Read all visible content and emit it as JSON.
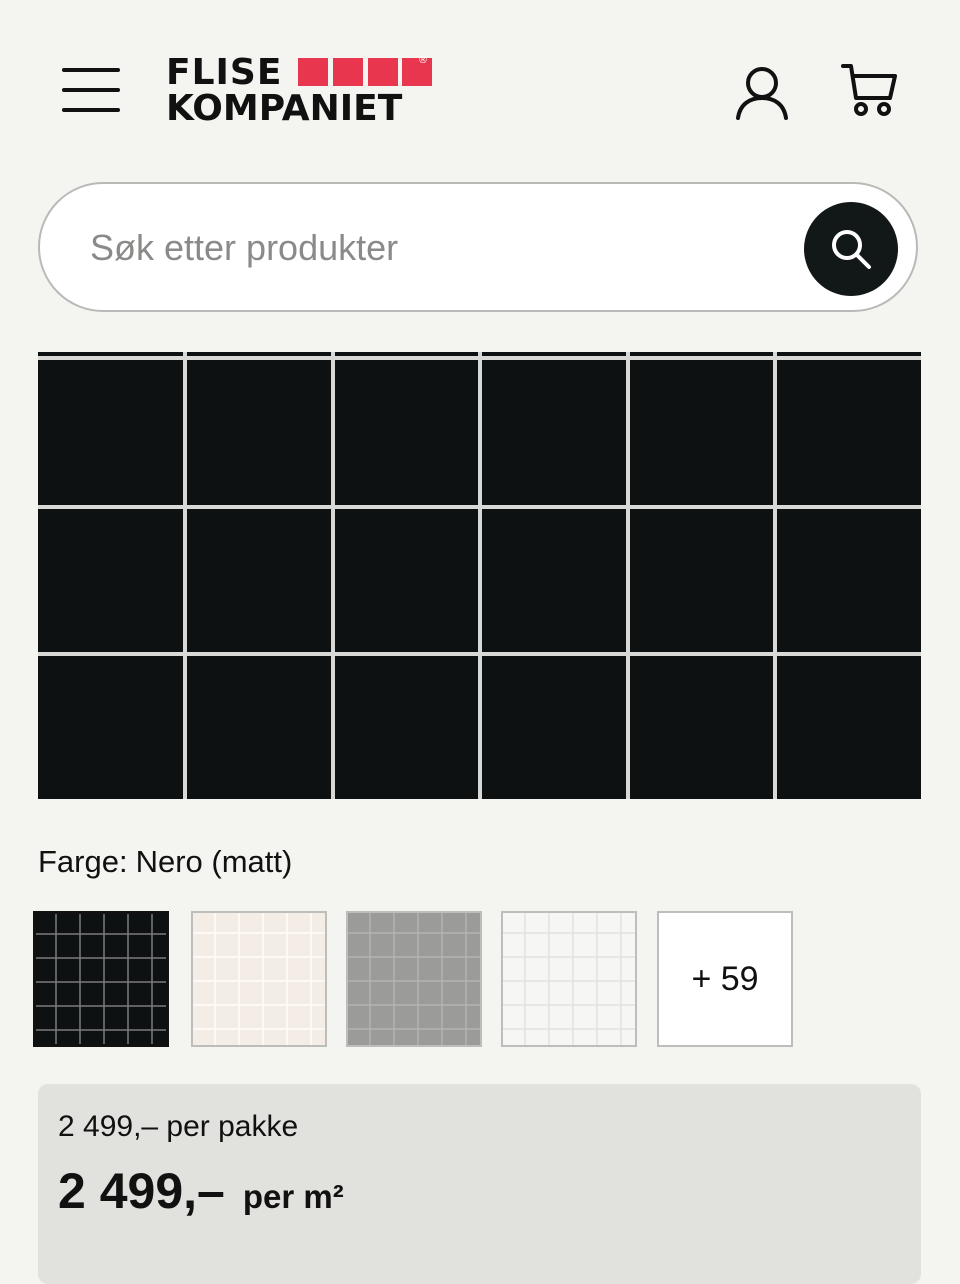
{
  "header": {
    "logo_line1": "FLISE",
    "logo_line2": "KOMPANIET",
    "logo_registered": "®",
    "menu_icon": "hamburger-menu-icon",
    "account_icon": "user-icon",
    "cart_icon": "shopping-cart-icon"
  },
  "search": {
    "placeholder": "Søk etter produkter",
    "value": "",
    "button_icon": "search-icon"
  },
  "product": {
    "image_alt": "Nero matt tile",
    "color_label": "Farge:",
    "color_value": "Nero (matt)",
    "swatches": [
      {
        "name": "Nero",
        "color": "#0d1111",
        "grout": "#8a8a8a",
        "selected": true
      },
      {
        "name": "Cream",
        "color": "#f1ebe3",
        "grout": "#e4dfd8",
        "selected": false
      },
      {
        "name": "Grey",
        "color": "#9a9a98",
        "grout": "#b0b0ae",
        "selected": false
      },
      {
        "name": "White",
        "color": "#f5f5f4",
        "grout": "#e4e4e2",
        "selected": false
      }
    ],
    "more_swatches_label": "+ 59"
  },
  "price": {
    "per_package": "2 499,– per pakke",
    "amount": "2 499,–",
    "unit": "per m²"
  },
  "colors": {
    "brand_red": "#e8364e",
    "background": "#f4f4f1",
    "search_button": "#121717",
    "price_panel": "#e1e1de"
  }
}
